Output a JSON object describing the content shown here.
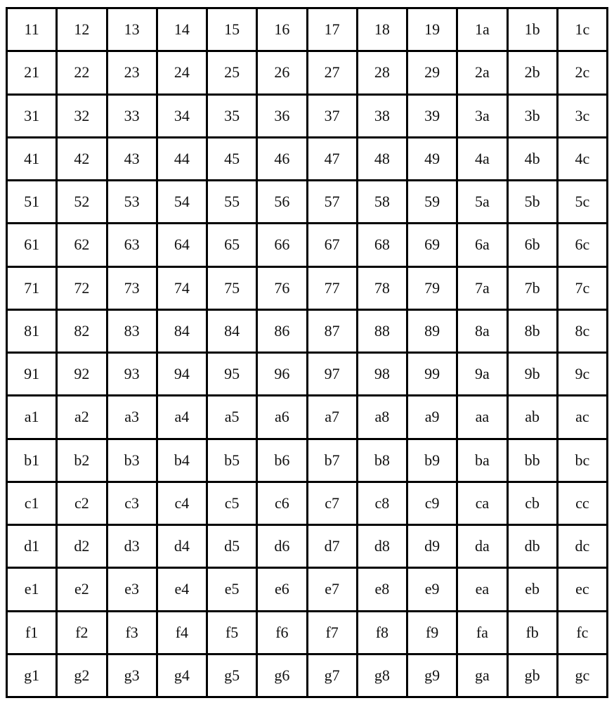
{
  "table": {
    "rows": [
      [
        "11",
        "12",
        "13",
        "14",
        "15",
        "16",
        "17",
        "18",
        "19",
        "1a",
        "1b",
        "1c"
      ],
      [
        "21",
        "22",
        "23",
        "24",
        "25",
        "26",
        "27",
        "28",
        "29",
        "2a",
        "2b",
        "2c"
      ],
      [
        "31",
        "32",
        "33",
        "34",
        "35",
        "36",
        "37",
        "38",
        "39",
        "3a",
        "3b",
        "3c"
      ],
      [
        "41",
        "42",
        "43",
        "44",
        "45",
        "46",
        "47",
        "48",
        "49",
        "4a",
        "4b",
        "4c"
      ],
      [
        "51",
        "52",
        "53",
        "54",
        "55",
        "56",
        "57",
        "58",
        "59",
        "5a",
        "5b",
        "5c"
      ],
      [
        "61",
        "62",
        "63",
        "64",
        "65",
        "66",
        "67",
        "68",
        "69",
        "6a",
        "6b",
        "6c"
      ],
      [
        "71",
        "72",
        "73",
        "74",
        "75",
        "76",
        "77",
        "78",
        "79",
        "7a",
        "7b",
        "7c"
      ],
      [
        "81",
        "82",
        "83",
        "84",
        "84",
        "86",
        "87",
        "88",
        "89",
        "8a",
        "8b",
        "8c"
      ],
      [
        "91",
        "92",
        "93",
        "94",
        "95",
        "96",
        "97",
        "98",
        "99",
        "9a",
        "9b",
        "9c"
      ],
      [
        "a1",
        "a2",
        "a3",
        "a4",
        "a5",
        "a6",
        "a7",
        "a8",
        "a9",
        "aa",
        "ab",
        "ac"
      ],
      [
        "b1",
        "b2",
        "b3",
        "b4",
        "b5",
        "b6",
        "b7",
        "b8",
        "b9",
        "ba",
        "bb",
        "bc"
      ],
      [
        "c1",
        "c2",
        "c3",
        "c4",
        "c5",
        "c6",
        "c7",
        "c8",
        "c9",
        "ca",
        "cb",
        "cc"
      ],
      [
        "d1",
        "d2",
        "d3",
        "d4",
        "d5",
        "d6",
        "d7",
        "d8",
        "d9",
        "da",
        "db",
        "dc"
      ],
      [
        "e1",
        "e2",
        "e3",
        "e4",
        "e5",
        "e6",
        "e7",
        "e8",
        "e9",
        "ea",
        "eb",
        "ec"
      ],
      [
        "f1",
        "f2",
        "f3",
        "f4",
        "f5",
        "f6",
        "f7",
        "f8",
        "f9",
        "fa",
        "fb",
        "fc"
      ],
      [
        "g1",
        "g2",
        "g3",
        "g4",
        "g5",
        "g6",
        "g7",
        "g8",
        "g9",
        "ga",
        "gb",
        "gc"
      ]
    ]
  }
}
